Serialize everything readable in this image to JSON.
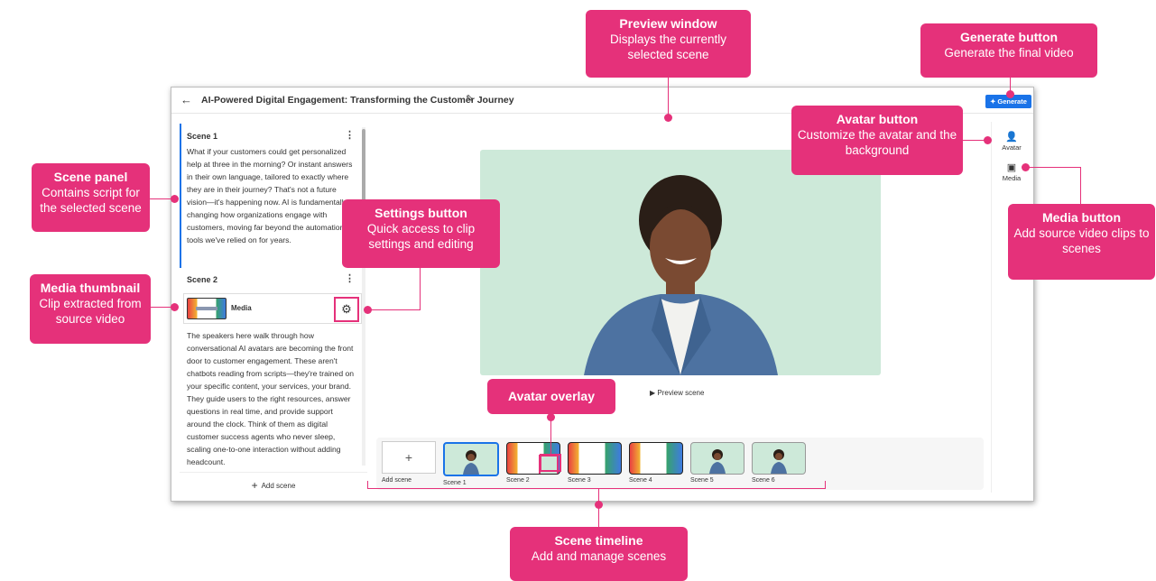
{
  "app": {
    "title": "AI-Powered Digital Engagement: Transforming the Customer Journey",
    "generate_label": "Generate",
    "scenes": [
      {
        "name": "Scene 1",
        "script": "What if your customers could get personalized help at three in the morning? Or instant answers in their own language, tailored to exactly where they are in their journey? That's not a future vision—it's happening now. AI is fundamentally changing how organizations engage with customers, moving far beyond the automation tools we've relied on for years."
      },
      {
        "name": "Scene 2",
        "media_label": "Media",
        "script": "The speakers here walk through how conversational AI avatars are becoming the front door to customer engagement. These aren't chatbots reading from scripts—they're trained on your specific content, your services, your brand. They guide users to the right resources, answer questions in real time, and provide support around the clock. Think of them as digital customer success agents who never sleep, scaling one-to-one interaction without adding headcount."
      }
    ],
    "add_scene_label": "Add scene",
    "preview_scene_label": "Preview scene",
    "rail": {
      "avatar_label": "Avatar",
      "media_label": "Media"
    },
    "timeline": {
      "add_label": "Add scene",
      "tiles": [
        "Scene 1",
        "Scene 2",
        "Scene 3",
        "Scene 4",
        "Scene 5",
        "Scene 6"
      ]
    }
  },
  "annotations": {
    "preview_window": {
      "title": "Preview window",
      "desc": "Displays the currently selected scene"
    },
    "generate_button": {
      "title": "Generate button",
      "desc": "Generate the final video"
    },
    "avatar_button": {
      "title": "Avatar button",
      "desc": "Customize the avatar and the background"
    },
    "media_button": {
      "title": "Media button",
      "desc": "Add source video clips to scenes"
    },
    "scene_panel": {
      "title": "Scene panel",
      "desc": "Contains script for the selected scene"
    },
    "settings_button": {
      "title": "Settings button",
      "desc": "Quick access to clip settings and editing"
    },
    "media_thumbnail": {
      "title": "Media thumbnail",
      "desc": "Clip extracted from source video"
    },
    "avatar_overlay": {
      "title": "Avatar overlay"
    },
    "scene_timeline": {
      "title": "Scene timeline",
      "desc": "Add and manage scenes"
    }
  },
  "colors": {
    "accent": "#e5317a",
    "primary_blue": "#1a73e8",
    "preview_bg": "#cde9d9"
  }
}
